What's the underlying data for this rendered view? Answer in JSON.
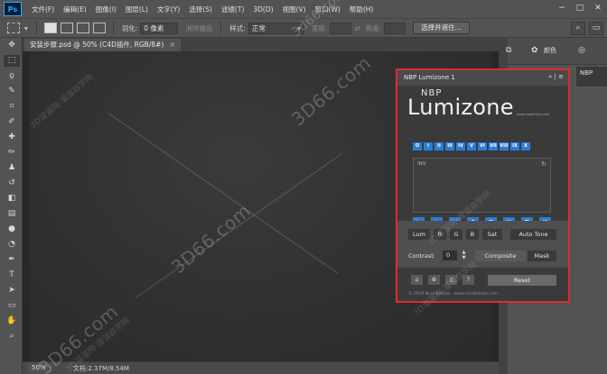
{
  "app": {
    "logo": "Ps",
    "menu": [
      "文件(F)",
      "编辑(E)",
      "图像(I)",
      "图层(L)",
      "文字(Y)",
      "选择(S)",
      "滤镜(T)",
      "3D(D)",
      "视图(V)",
      "窗口(W)",
      "帮助(H)"
    ]
  },
  "options": {
    "feather_label": "羽化:",
    "feather_value": "0 像素",
    "antialias_label": "消除锯齿",
    "style_label": "样式:",
    "style_value": "正常",
    "width_label": "宽度:",
    "height_label": "高度:",
    "select_mask_button": "选择并遮住..."
  },
  "document": {
    "tab_title": "安装步骤.psd @ 50% (C4D插件, RGB/8#)",
    "zoom": "50%",
    "doc_info": "文档:2.37M/8.54M"
  },
  "right_dock": {
    "adjust_label": "颜色",
    "nbp_tab": "NBP"
  },
  "lumizone": {
    "title": "NBP Lumizone 1",
    "logo_top": "NBP",
    "logo_main": "Lumizone",
    "logo_url": "www.nbpatricks.com",
    "zones": [
      "O",
      "I",
      "II",
      "III",
      "IV",
      "V",
      "VI",
      "VII",
      "VIII",
      "IX",
      "X"
    ],
    "inv_label": "INV",
    "lum_button": "Lum",
    "r_button": "R",
    "g_button": "G",
    "b_button": "B",
    "sat_button": "Sat",
    "auto_tone_button": "Auto Tone",
    "contrast_label": "Contrast:",
    "contrast_value": "0",
    "composite_button": "Composite",
    "mask_button": "Mask",
    "reset_button": "Reset",
    "copyright": "© 2019 Nino Batista - www.ninobatista.com"
  },
  "watermarks": {
    "site": "3D66.com",
    "site_alt": "3d66.com",
    "cn_text": "3D溜溜网-溜溜自学网"
  },
  "colors": {
    "accent_blue": "#2b7cd9",
    "highlight_red": "#e02b2b",
    "ps_blue": "#31a8ff"
  }
}
